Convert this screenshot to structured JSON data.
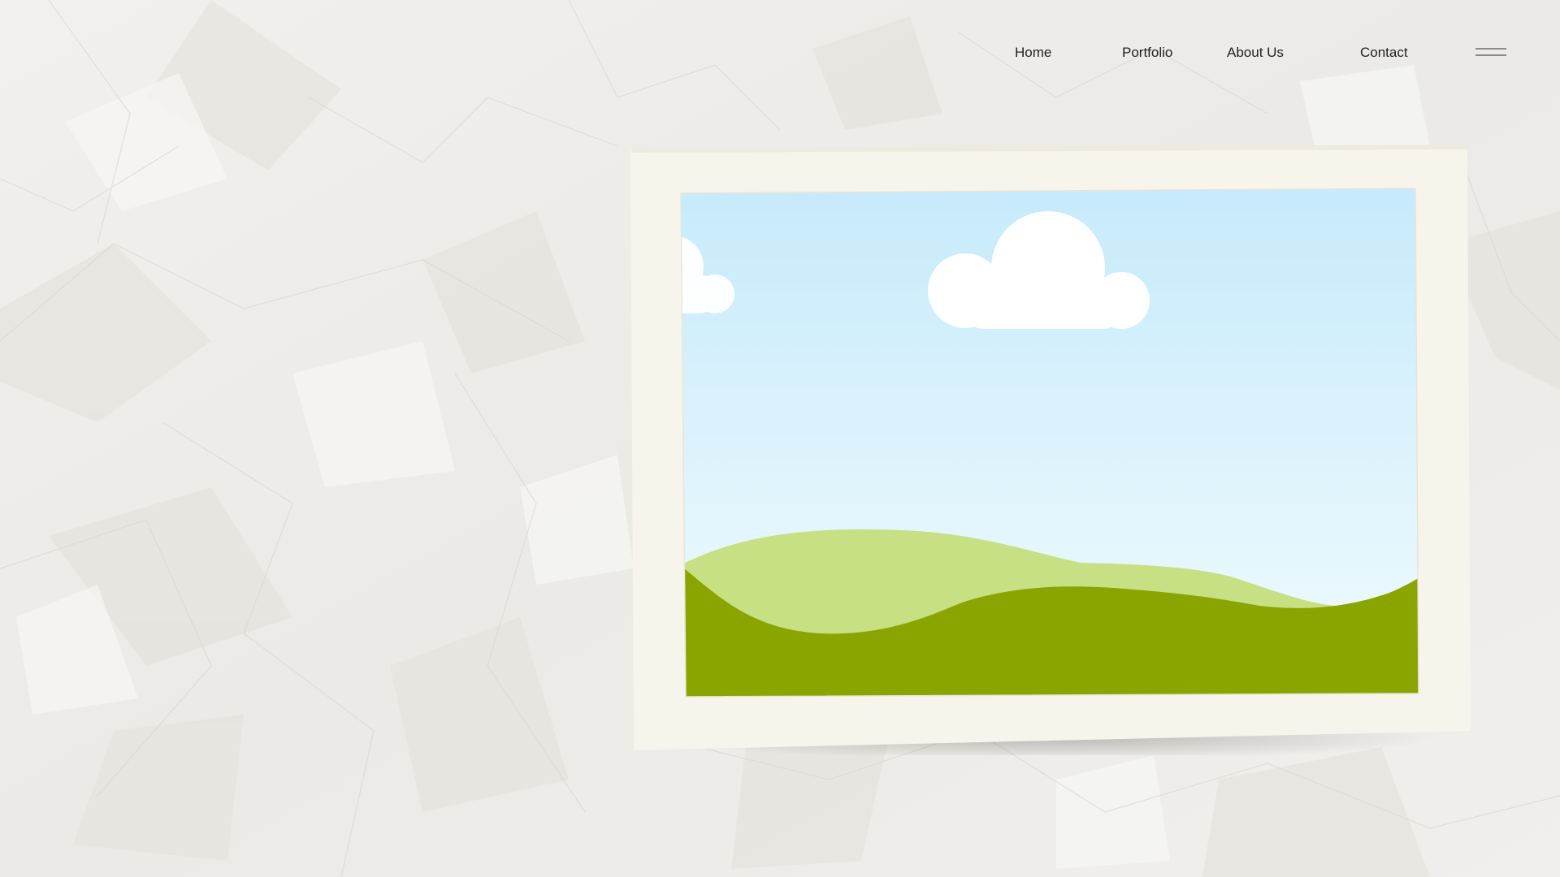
{
  "nav": {
    "home_label": "Home",
    "portfolio_label": "Portfolio",
    "about_label": "About Us",
    "contact_label": "Contact",
    "menu_icon": "hamburger-menu-icon"
  },
  "photo": {
    "illustration": "landscape-placeholder-image",
    "colors": {
      "sky_top": "#c6eafc",
      "sky_bottom": "#f2fbfd",
      "hill_light": "#c7e083",
      "hill_dark": "#8aa500",
      "frame": "#f7f4ec",
      "cloud": "#ffffff"
    }
  },
  "theme": {
    "background": "#efedea",
    "text": "#222222"
  }
}
